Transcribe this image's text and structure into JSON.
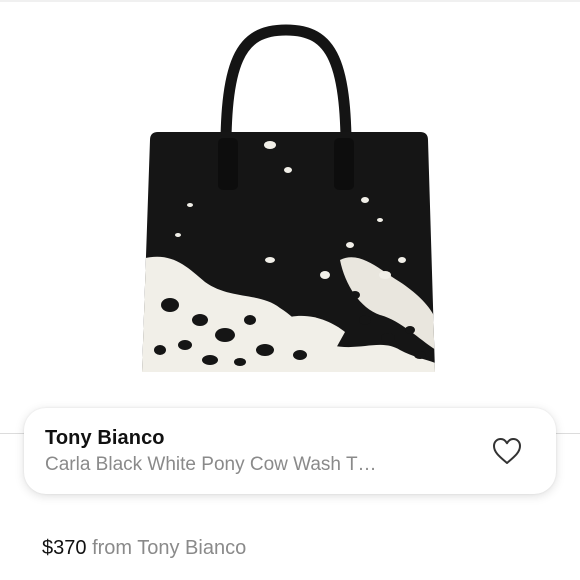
{
  "product": {
    "image_alt": "Black and white pony hair tote bag",
    "brand": "Tony Bianco",
    "title": "Carla Black White Pony Cow Wash T…"
  },
  "listing": {
    "price": "$370",
    "seller_text": "from Tony Bianco"
  },
  "icons": {
    "favorite": "heart-outline-icon"
  },
  "colors": {
    "text_primary": "#111111",
    "text_secondary": "#8a8a8a",
    "bag_black": "#141414",
    "bag_white": "#f2f0ea"
  }
}
